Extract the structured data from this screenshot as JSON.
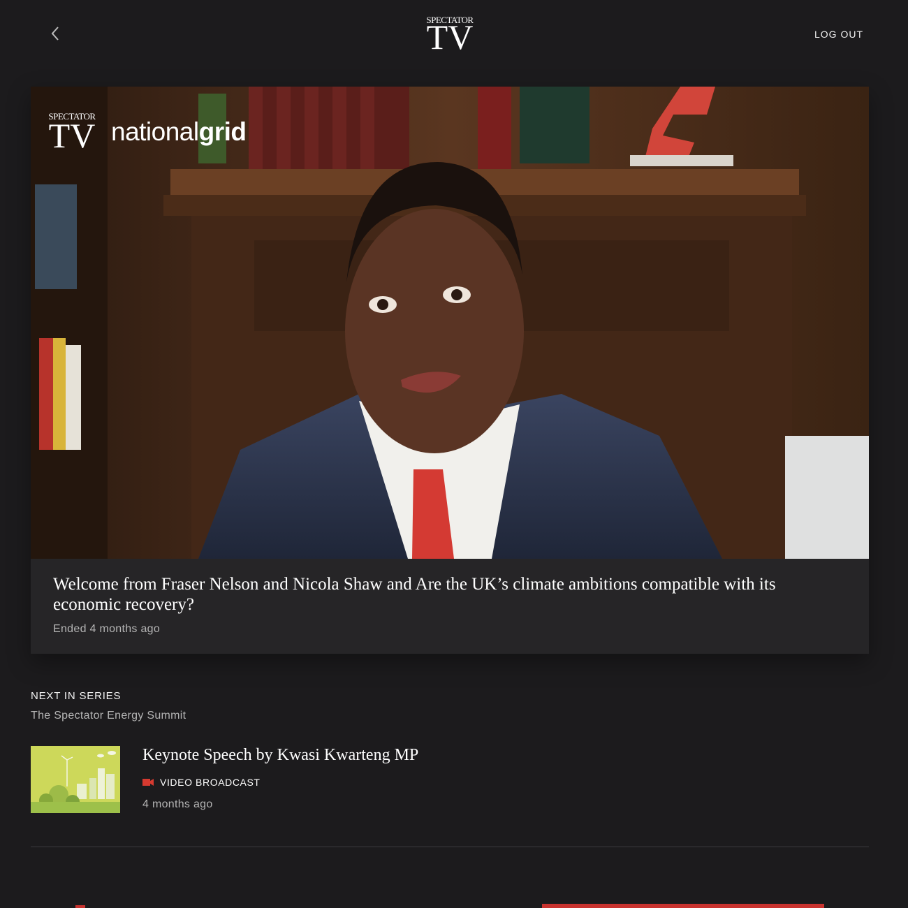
{
  "header": {
    "back_label": "back",
    "logo_small": "SPECTATOR",
    "logo_large": "TV",
    "logout_label": "LOG OUT"
  },
  "hero": {
    "overlay_logo_small": "SPECTATOR",
    "overlay_logo_large": "TV",
    "sponsor_light": "national",
    "sponsor_bold": "grid",
    "title": "Welcome from Fraser Nelson and Nicola Shaw and Are the UK’s climate ambitions compatible with its economic recovery?",
    "status": "Ended 4 months ago"
  },
  "series": {
    "label": "NEXT IN SERIES",
    "name": "The Spectator Energy Summit",
    "items": [
      {
        "title": "Keynote Speech by Kwasi Kwarteng MP",
        "type_icon": "video-camera-icon",
        "type_label": "VIDEO BROADCAST",
        "time": "4 months ago"
      }
    ]
  },
  "colors": {
    "background": "#1c1b1d",
    "card": "#262527",
    "accent_red": "#c8332f"
  }
}
